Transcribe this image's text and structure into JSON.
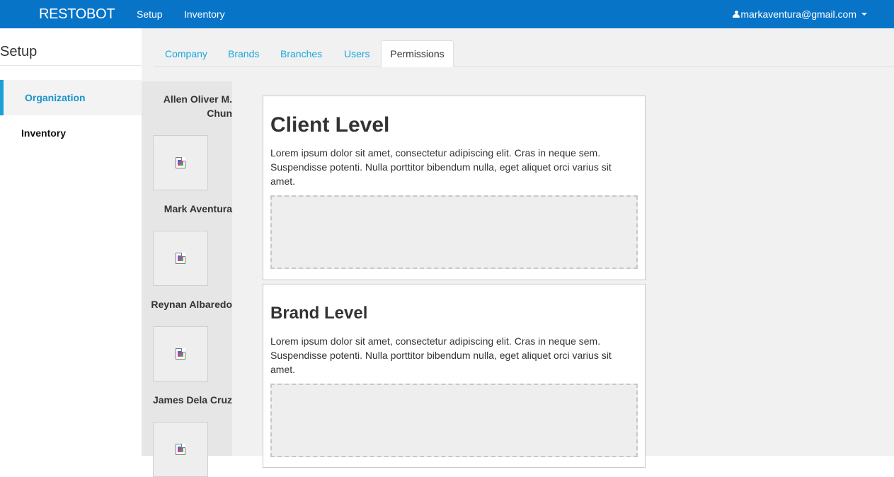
{
  "navbar": {
    "brand": "RESTOBOT",
    "links": [
      "Setup",
      "Inventory"
    ],
    "user_email": "markaventura@gmail.com"
  },
  "sidebar": {
    "title": "Setup",
    "items": [
      {
        "label": "Organization",
        "active": true
      },
      {
        "label": "Inventory",
        "active": false
      }
    ]
  },
  "tabs": {
    "items": [
      "Company",
      "Brands",
      "Branches",
      "Users"
    ],
    "active": "Permissions"
  },
  "users": [
    {
      "name": "Allen Oliver M. Chun"
    },
    {
      "name": "Mark Aventura"
    },
    {
      "name": "Reynan Albaredo"
    },
    {
      "name": "James Dela Cruz"
    }
  ],
  "panels": [
    {
      "title": "Client Level",
      "body": "Lorem ipsum dolor sit amet, consectetur adipiscing elit. Cras in neque sem. Suspendisse potenti. Nulla porttitor bibendum nulla, eget aliquet orci varius sit amet."
    },
    {
      "title": "Brand Level",
      "body": "Lorem ipsum dolor sit amet, consectetur adipiscing elit. Cras in neque sem. Suspendisse potenti. Nulla porttitor bibendum nulla, eget aliquet orci varius sit amet."
    }
  ],
  "colors": {
    "navbar_bg": "#0774c8",
    "link_blue": "#19a8dc",
    "active_accent": "#1aa0d8"
  }
}
